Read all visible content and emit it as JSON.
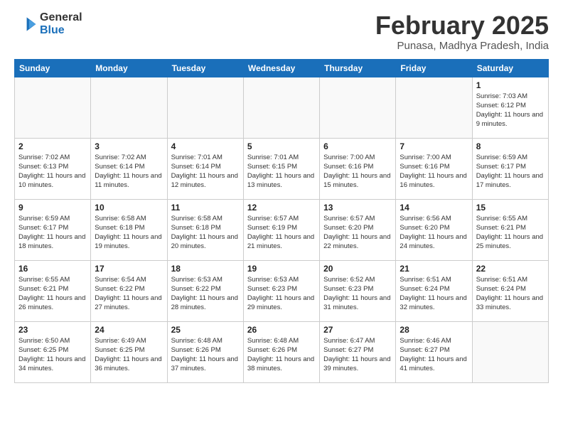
{
  "header": {
    "logo_general": "General",
    "logo_blue": "Blue",
    "month_year": "February 2025",
    "location": "Punasa, Madhya Pradesh, India"
  },
  "weekdays": [
    "Sunday",
    "Monday",
    "Tuesday",
    "Wednesday",
    "Thursday",
    "Friday",
    "Saturday"
  ],
  "weeks": [
    [
      {
        "day": "",
        "info": ""
      },
      {
        "day": "",
        "info": ""
      },
      {
        "day": "",
        "info": ""
      },
      {
        "day": "",
        "info": ""
      },
      {
        "day": "",
        "info": ""
      },
      {
        "day": "",
        "info": ""
      },
      {
        "day": "1",
        "info": "Sunrise: 7:03 AM\nSunset: 6:12 PM\nDaylight: 11 hours and 9 minutes."
      }
    ],
    [
      {
        "day": "2",
        "info": "Sunrise: 7:02 AM\nSunset: 6:13 PM\nDaylight: 11 hours and 10 minutes."
      },
      {
        "day": "3",
        "info": "Sunrise: 7:02 AM\nSunset: 6:14 PM\nDaylight: 11 hours and 11 minutes."
      },
      {
        "day": "4",
        "info": "Sunrise: 7:01 AM\nSunset: 6:14 PM\nDaylight: 11 hours and 12 minutes."
      },
      {
        "day": "5",
        "info": "Sunrise: 7:01 AM\nSunset: 6:15 PM\nDaylight: 11 hours and 13 minutes."
      },
      {
        "day": "6",
        "info": "Sunrise: 7:00 AM\nSunset: 6:16 PM\nDaylight: 11 hours and 15 minutes."
      },
      {
        "day": "7",
        "info": "Sunrise: 7:00 AM\nSunset: 6:16 PM\nDaylight: 11 hours and 16 minutes."
      },
      {
        "day": "8",
        "info": "Sunrise: 6:59 AM\nSunset: 6:17 PM\nDaylight: 11 hours and 17 minutes."
      }
    ],
    [
      {
        "day": "9",
        "info": "Sunrise: 6:59 AM\nSunset: 6:17 PM\nDaylight: 11 hours and 18 minutes."
      },
      {
        "day": "10",
        "info": "Sunrise: 6:58 AM\nSunset: 6:18 PM\nDaylight: 11 hours and 19 minutes."
      },
      {
        "day": "11",
        "info": "Sunrise: 6:58 AM\nSunset: 6:18 PM\nDaylight: 11 hours and 20 minutes."
      },
      {
        "day": "12",
        "info": "Sunrise: 6:57 AM\nSunset: 6:19 PM\nDaylight: 11 hours and 21 minutes."
      },
      {
        "day": "13",
        "info": "Sunrise: 6:57 AM\nSunset: 6:20 PM\nDaylight: 11 hours and 22 minutes."
      },
      {
        "day": "14",
        "info": "Sunrise: 6:56 AM\nSunset: 6:20 PM\nDaylight: 11 hours and 24 minutes."
      },
      {
        "day": "15",
        "info": "Sunrise: 6:55 AM\nSunset: 6:21 PM\nDaylight: 11 hours and 25 minutes."
      }
    ],
    [
      {
        "day": "16",
        "info": "Sunrise: 6:55 AM\nSunset: 6:21 PM\nDaylight: 11 hours and 26 minutes."
      },
      {
        "day": "17",
        "info": "Sunrise: 6:54 AM\nSunset: 6:22 PM\nDaylight: 11 hours and 27 minutes."
      },
      {
        "day": "18",
        "info": "Sunrise: 6:53 AM\nSunset: 6:22 PM\nDaylight: 11 hours and 28 minutes."
      },
      {
        "day": "19",
        "info": "Sunrise: 6:53 AM\nSunset: 6:23 PM\nDaylight: 11 hours and 29 minutes."
      },
      {
        "day": "20",
        "info": "Sunrise: 6:52 AM\nSunset: 6:23 PM\nDaylight: 11 hours and 31 minutes."
      },
      {
        "day": "21",
        "info": "Sunrise: 6:51 AM\nSunset: 6:24 PM\nDaylight: 11 hours and 32 minutes."
      },
      {
        "day": "22",
        "info": "Sunrise: 6:51 AM\nSunset: 6:24 PM\nDaylight: 11 hours and 33 minutes."
      }
    ],
    [
      {
        "day": "23",
        "info": "Sunrise: 6:50 AM\nSunset: 6:25 PM\nDaylight: 11 hours and 34 minutes."
      },
      {
        "day": "24",
        "info": "Sunrise: 6:49 AM\nSunset: 6:25 PM\nDaylight: 11 hours and 36 minutes."
      },
      {
        "day": "25",
        "info": "Sunrise: 6:48 AM\nSunset: 6:26 PM\nDaylight: 11 hours and 37 minutes."
      },
      {
        "day": "26",
        "info": "Sunrise: 6:48 AM\nSunset: 6:26 PM\nDaylight: 11 hours and 38 minutes."
      },
      {
        "day": "27",
        "info": "Sunrise: 6:47 AM\nSunset: 6:27 PM\nDaylight: 11 hours and 39 minutes."
      },
      {
        "day": "28",
        "info": "Sunrise: 6:46 AM\nSunset: 6:27 PM\nDaylight: 11 hours and 41 minutes."
      },
      {
        "day": "",
        "info": ""
      }
    ]
  ]
}
